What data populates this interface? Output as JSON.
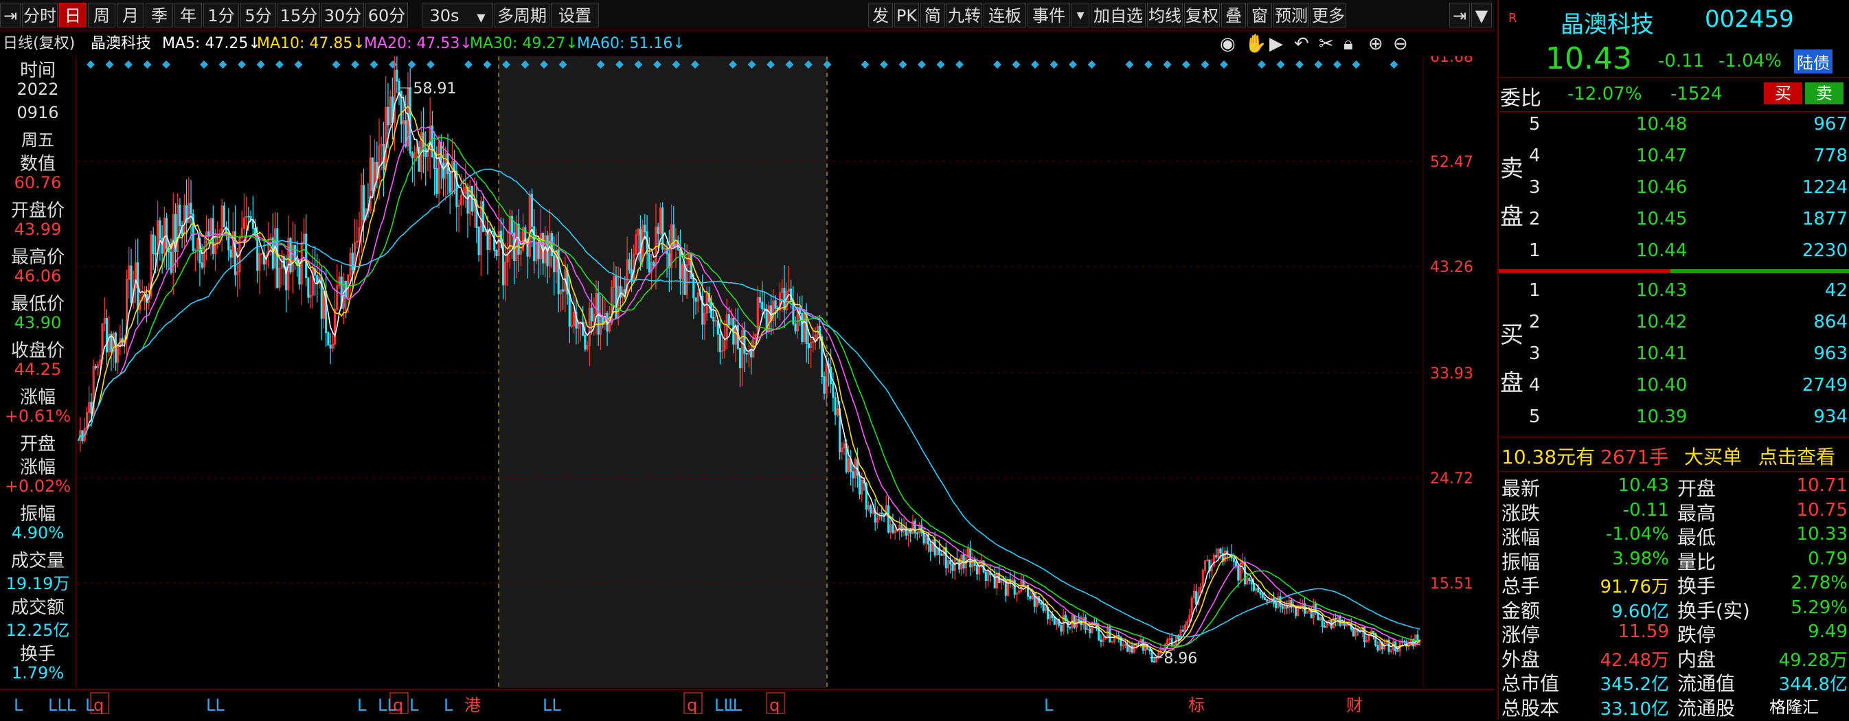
{
  "toolbar": {
    "left_tabs": [
      "分时",
      "日",
      "周",
      "月",
      "季",
      "年",
      "1分",
      "5分",
      "15分",
      "30分",
      "60分"
    ],
    "active_tab": "日",
    "period_select": "30s",
    "extra_left": [
      "多周期",
      "设置"
    ],
    "right_tools": [
      "发",
      "PK",
      "简",
      "九转",
      "连板",
      "事件",
      "加自选",
      "均线",
      "复权",
      "叠",
      "窗",
      "预测",
      "更多"
    ]
  },
  "ma_bar": {
    "mode": "日线(复权)",
    "stock": "晶澳科技",
    "ma5": "MA5: 47.25↓",
    "ma10": "MA10: 47.85↓",
    "ma20": "MA20: 47.53↓",
    "ma30": "MA30: 49.27↓",
    "ma60": "MA60: 51.16↓"
  },
  "left_info": [
    {
      "label": "时间",
      "value": "2022"
    },
    {
      "label": "",
      "value": "0916"
    },
    {
      "label": "",
      "value": "周五"
    },
    {
      "label": "数值",
      "value": "60.76"
    },
    {
      "label": "开盘价",
      "value": "43.99"
    },
    {
      "label": "最高价",
      "value": "46.06"
    },
    {
      "label": "最低价",
      "value": "43.90"
    },
    {
      "label": "收盘价",
      "value": "44.25"
    },
    {
      "label": "涨幅",
      "value": "+0.61%"
    },
    {
      "label": "开盘",
      "value": ""
    },
    {
      "label": "涨幅",
      "value": "+0.02%"
    },
    {
      "label": "振幅",
      "value": "4.90%"
    },
    {
      "label": "成交量",
      "value": "19.19万"
    },
    {
      "label": "成交额",
      "value": "12.25亿"
    },
    {
      "label": "换手",
      "value": "1.79%"
    }
  ],
  "colors": {
    "up": "#ff3b3b",
    "down": "#2ee6ff",
    "ma5": "#ffffff",
    "ma10": "#ffe100",
    "ma20": "#ff5cff",
    "ma30": "#27d827",
    "ma60": "#33ccff",
    "grid": "#5a0000"
  },
  "chart_data": {
    "type": "candlestick",
    "y_ticks": [
      "61.68",
      "52.47",
      "43.26",
      "33.93",
      "24.72",
      "15.51"
    ],
    "ylim": [
      6.3,
      61.68
    ],
    "annotations": {
      "high": "58.91",
      "low": "8.96"
    },
    "close_series": [
      28,
      32,
      38,
      36,
      42,
      40,
      47,
      45,
      48,
      46,
      45,
      47,
      44,
      46,
      45,
      44,
      43,
      44,
      41,
      38,
      42,
      47,
      52,
      55,
      58,
      56,
      54,
      52,
      50,
      48,
      47,
      45,
      44,
      46,
      47,
      45,
      43,
      40,
      38,
      39,
      40,
      42,
      44,
      45,
      46,
      44,
      42,
      40,
      38,
      37,
      36,
      38,
      40,
      41,
      40,
      38,
      35,
      30,
      26,
      24,
      22,
      21,
      21,
      20,
      19,
      18,
      17,
      18,
      17,
      16,
      15,
      15,
      14,
      13,
      12,
      12,
      12,
      11,
      11,
      10,
      10,
      9,
      10,
      11,
      14,
      17,
      18,
      17,
      16,
      15,
      14,
      14,
      13,
      13,
      12,
      12,
      11,
      11,
      10,
      10,
      10,
      11
    ],
    "bottom_markers": [
      "L",
      "LLL",
      "L",
      "q",
      "LL",
      "L",
      "LL",
      "q",
      "L",
      "L",
      "港",
      "LL",
      "q",
      "LLL",
      "L",
      "q",
      "L",
      "标",
      "财"
    ]
  },
  "quote": {
    "flag": "R",
    "name": "晶澳科技",
    "code": "002459",
    "price": "10.43",
    "change": "-0.11",
    "change_pct": "-1.04%",
    "board": "陆债",
    "weibi_label": "委比",
    "weibi_value": "-12.07%",
    "weicha_value": "-1524",
    "buy_btn": "买",
    "sell_btn": "卖",
    "sell_label": [
      "卖",
      "盘"
    ],
    "buy_label": [
      "买",
      "盘"
    ],
    "sell_orders": [
      {
        "level": "5",
        "price": "10.48",
        "vol": "967"
      },
      {
        "level": "4",
        "price": "10.47",
        "vol": "778"
      },
      {
        "level": "3",
        "price": "10.46",
        "vol": "1224"
      },
      {
        "level": "2",
        "price": "10.45",
        "vol": "1877"
      },
      {
        "level": "1",
        "price": "10.44",
        "vol": "2230"
      }
    ],
    "buy_orders": [
      {
        "level": "1",
        "price": "10.43",
        "vol": "42"
      },
      {
        "level": "2",
        "price": "10.42",
        "vol": "864"
      },
      {
        "level": "3",
        "price": "10.41",
        "vol": "963"
      },
      {
        "level": "4",
        "price": "10.40",
        "vol": "2749"
      },
      {
        "level": "5",
        "price": "10.39",
        "vol": "934"
      }
    ],
    "big_order": {
      "price": "10.38元有",
      "vol": "2671手",
      "label": "大买单",
      "link": "点击查看"
    },
    "stats": [
      {
        "l1": "最新",
        "v1": "10.43",
        "c1": "green",
        "l2": "开盘",
        "v2": "10.71",
        "c2": "red"
      },
      {
        "l1": "涨跌",
        "v1": "-0.11",
        "c1": "green",
        "l2": "最高",
        "v2": "10.75",
        "c2": "red"
      },
      {
        "l1": "涨幅",
        "v1": "-1.04%",
        "c1": "green",
        "l2": "最低",
        "v2": "10.33",
        "c2": "green"
      },
      {
        "l1": "振幅",
        "v1": "3.98%",
        "c1": "green",
        "l2": "量比",
        "v2": "0.79",
        "c2": "green"
      },
      {
        "l1": "总手",
        "v1": "91.76万",
        "c1": "yellow",
        "l2": "换手",
        "v2": "2.78%",
        "c2": "green"
      },
      {
        "l1": "金额",
        "v1": "9.60亿",
        "c1": "cyan",
        "l2": "换手(实)",
        "v2": "5.29%",
        "c2": "green"
      },
      {
        "l1": "涨停",
        "v1": "11.59",
        "c1": "red",
        "l2": "跌停",
        "v2": "9.49",
        "c2": "green"
      },
      {
        "l1": "外盘",
        "v1": "42.48万",
        "c1": "red",
        "l2": "内盘",
        "v2": "49.28万",
        "c2": "green"
      },
      {
        "l1": "总市值",
        "v1": "345.2亿",
        "c1": "cyan",
        "l2": "流通值",
        "v2": "344.8亿",
        "c2": "cyan"
      },
      {
        "l1": "总股本",
        "v1": "33.10亿",
        "c1": "cyan",
        "l2": "流通股",
        "v2": "",
        "c2": "cyan"
      }
    ],
    "watermark": "格隆汇"
  }
}
